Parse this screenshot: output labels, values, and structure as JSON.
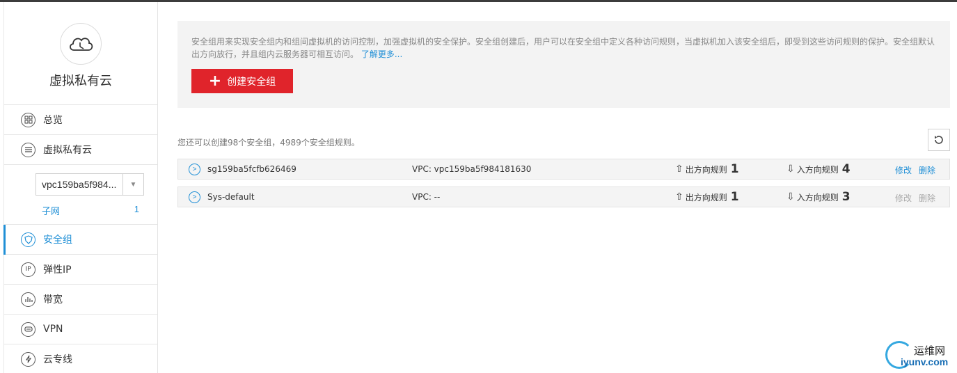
{
  "sidebar": {
    "title": "虚拟私有云",
    "items": [
      {
        "label": "总览",
        "icon": "dashboard-icon"
      },
      {
        "label": "虚拟私有云",
        "icon": "list-icon"
      },
      {
        "label": "安全组",
        "icon": "shield-icon",
        "active": true
      },
      {
        "label": "弹性IP",
        "icon": "ip-icon"
      },
      {
        "label": "带宽",
        "icon": "bandwidth-icon"
      },
      {
        "label": "VPN",
        "icon": "vpn-icon"
      },
      {
        "label": "云专线",
        "icon": "direct-connect-icon"
      }
    ],
    "vpc_select": {
      "value": "vpc159ba5f984..."
    },
    "subnet": {
      "label": "子网",
      "count": "1"
    }
  },
  "info": {
    "text": "安全组用来实现安全组内和组间虚拟机的访问控制，加强虚拟机的安全保护。安全组创建后，用户可以在安全组中定义各种访问规则，当虚拟机加入该安全组后，即受到这些访问规则的保护。安全组默认出方向放行，并且组内云服务器可相互访问。",
    "link": "了解更多..."
  },
  "create_button": {
    "label": "创建安全组"
  },
  "quota_text": "您还可以创建98个安全组，4989个安全组规则。",
  "security_groups": [
    {
      "name": "sg159ba5fcfb626469",
      "vpc": "VPC: vpc159ba5f984181630",
      "out_label": "出方向规则",
      "out_count": "1",
      "in_label": "入方向规则",
      "in_count": "4",
      "edit": "修改",
      "delete": "删除",
      "actions_enabled": true
    },
    {
      "name": "Sys-default",
      "vpc": "VPC:  --",
      "out_label": "出方向规则",
      "out_count": "1",
      "in_label": "入方向规则",
      "in_count": "3",
      "edit": "修改",
      "delete": "删除",
      "actions_enabled": false
    }
  ],
  "watermark": {
    "cn": "运维网",
    "en": "iyunv.com"
  },
  "colors": {
    "accent": "#1f8fd6",
    "primary_button": "#e0242b",
    "panel_bg": "#f3f3f3"
  }
}
